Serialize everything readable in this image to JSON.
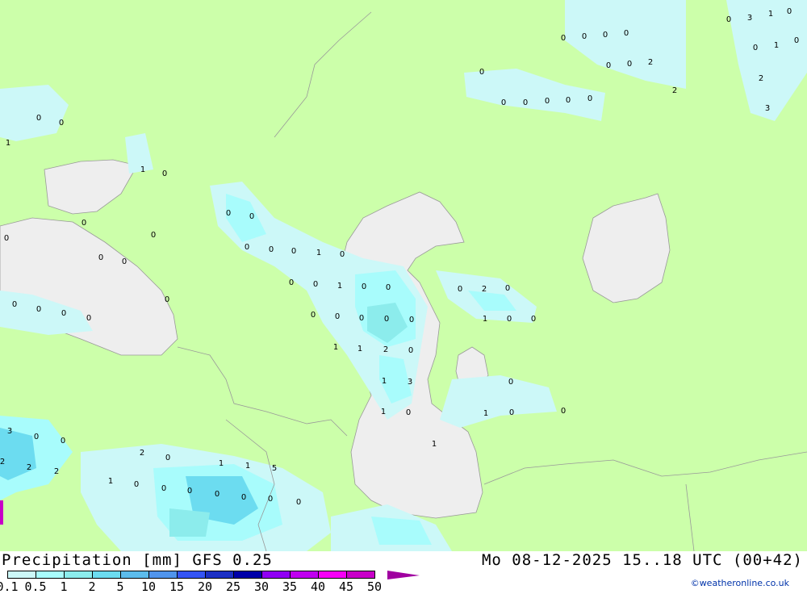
{
  "header": {
    "title": "Precipitation [mm]  GFS 0.25",
    "valid_time": "Mo 08-12-2025 15..18 UTC (00+42)"
  },
  "legend": {
    "ticks": [
      "0.1",
      "0.5",
      "1",
      "2",
      "5",
      "10",
      "15",
      "20",
      "25",
      "30",
      "35",
      "40",
      "45",
      "50"
    ],
    "colors": [
      "#ccf8f8",
      "#a8fcfc",
      "#8cecec",
      "#6cdcf0",
      "#5cbcec",
      "#5094ec",
      "#3454f4",
      "#1c30c4",
      "#0000a8",
      "#9000f4",
      "#c000f0",
      "#f800f8",
      "#c800c8",
      "#a000a0"
    ]
  },
  "credit": "©weatheronline.co.uk",
  "map": {
    "land_color": "#ccffaa",
    "sea_color": "#eeeeee",
    "precip_colors": [
      "#ccf8f8",
      "#a8fcfc",
      "#8cecec",
      "#6cdcf0"
    ],
    "point_values": [
      "0",
      "0",
      "1",
      "1",
      "0",
      "0",
      "0",
      "0",
      "0",
      "0",
      "0",
      "0",
      "0",
      "0",
      "0",
      "0",
      "0",
      "0",
      "0",
      "0",
      "1",
      "0",
      "0",
      "0",
      "1",
      "0",
      "0",
      "0",
      "0",
      "0",
      "0",
      "0",
      "1",
      "1",
      "2",
      "0",
      "1",
      "3",
      "1",
      "0",
      "1",
      "0",
      "2",
      "0",
      "1",
      "0",
      "0",
      "0",
      "1",
      "0",
      "0",
      "0",
      "0",
      "0",
      "0",
      "0",
      "0",
      "0",
      "0",
      "0",
      "0",
      "0",
      "0",
      "2",
      "2",
      "0",
      "3",
      "1",
      "0",
      "0",
      "1",
      "0",
      "2",
      "3",
      "3",
      "0",
      "0",
      "2",
      "2",
      "2",
      "2",
      "0",
      "1",
      "1",
      "5",
      "1",
      "0",
      "0",
      "0",
      "0",
      "0",
      "0",
      "0"
    ]
  }
}
